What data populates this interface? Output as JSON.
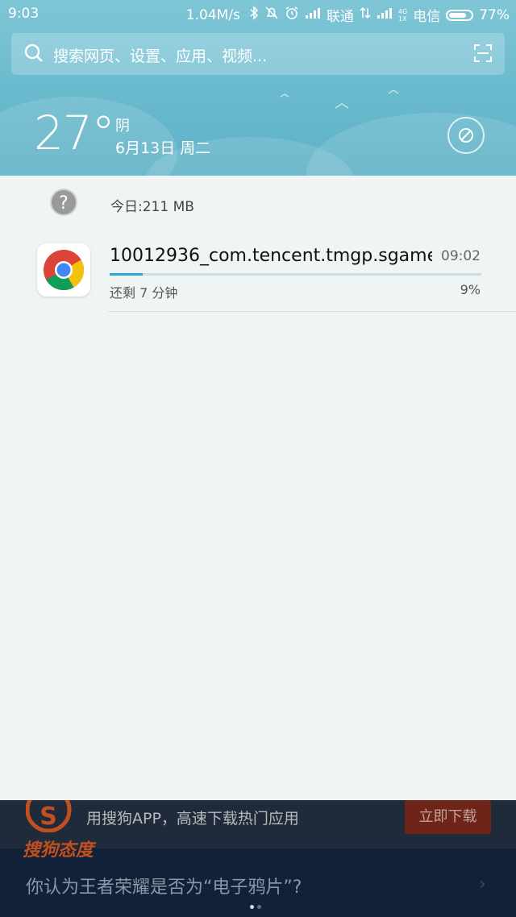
{
  "status_bar": {
    "time": "9:03",
    "net_speed": "1.04M/s",
    "carrier1": "联通",
    "carrier2": "电信",
    "net_type_top": "4G",
    "net_type_bottom": "1X",
    "battery": "77%"
  },
  "search": {
    "placeholder": "搜索网页、设置、应用、视频..."
  },
  "weather": {
    "temperature": "27°",
    "condition": "阴",
    "date": "6月13日 周二"
  },
  "data_usage": {
    "text": "今日:211 MB"
  },
  "download_notification": {
    "title": "10012936_com.tencent.tmgp.sgame_..",
    "time": "09:02",
    "remaining": "还剩 7 分钟",
    "percent_label": "9%",
    "progress_fraction": 0.09,
    "accent_color": "#29a6d6"
  },
  "background_ad": {
    "logo_text": "搜狗态度",
    "text": "用搜狗APP，高速下载热门应用",
    "button": "立即下载"
  },
  "background_question": {
    "text": "你认为王者荣耀是否为“电子鸦片”?"
  },
  "page_dots": {
    "count": 2,
    "active": 0
  }
}
